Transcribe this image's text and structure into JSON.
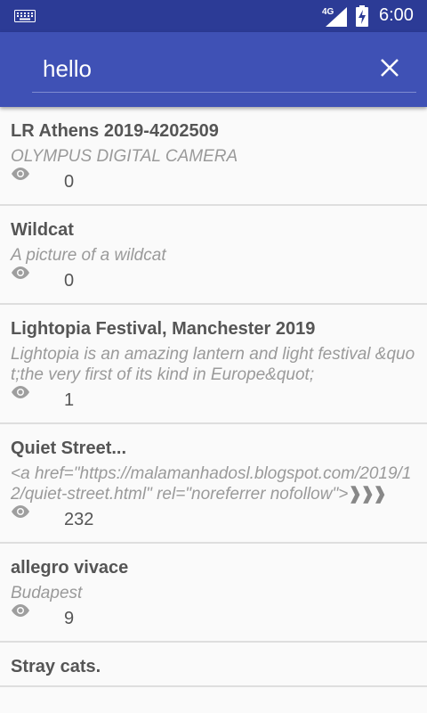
{
  "status_bar": {
    "network": "4G",
    "time": "6:00"
  },
  "search": {
    "query": "hello"
  },
  "items": [
    {
      "title": "LR Athens 2019-4202509",
      "description": "OLYMPUS DIGITAL CAMERA",
      "views": "0"
    },
    {
      "title": "Wildcat",
      "description": "A picture of a wildcat",
      "views": "0"
    },
    {
      "title": "Lightopia Festival, Manchester 2019",
      "description": "Lightopia is an amazing lantern and light festival &quot;the very first of its kind in Europe&quot;",
      "views": "1"
    },
    {
      "title": "Quiet Street...",
      "description": "<a href=\"https://malamanhadosl.blogspot.com/2019/12/quiet-street.html\" rel=\"noreferrer nofollow\">",
      "views": "232"
    },
    {
      "title": "allegro vivace",
      "description": "Budapest",
      "views": "9"
    },
    {
      "title": "Stray cats.",
      "description": "",
      "views": ""
    }
  ]
}
